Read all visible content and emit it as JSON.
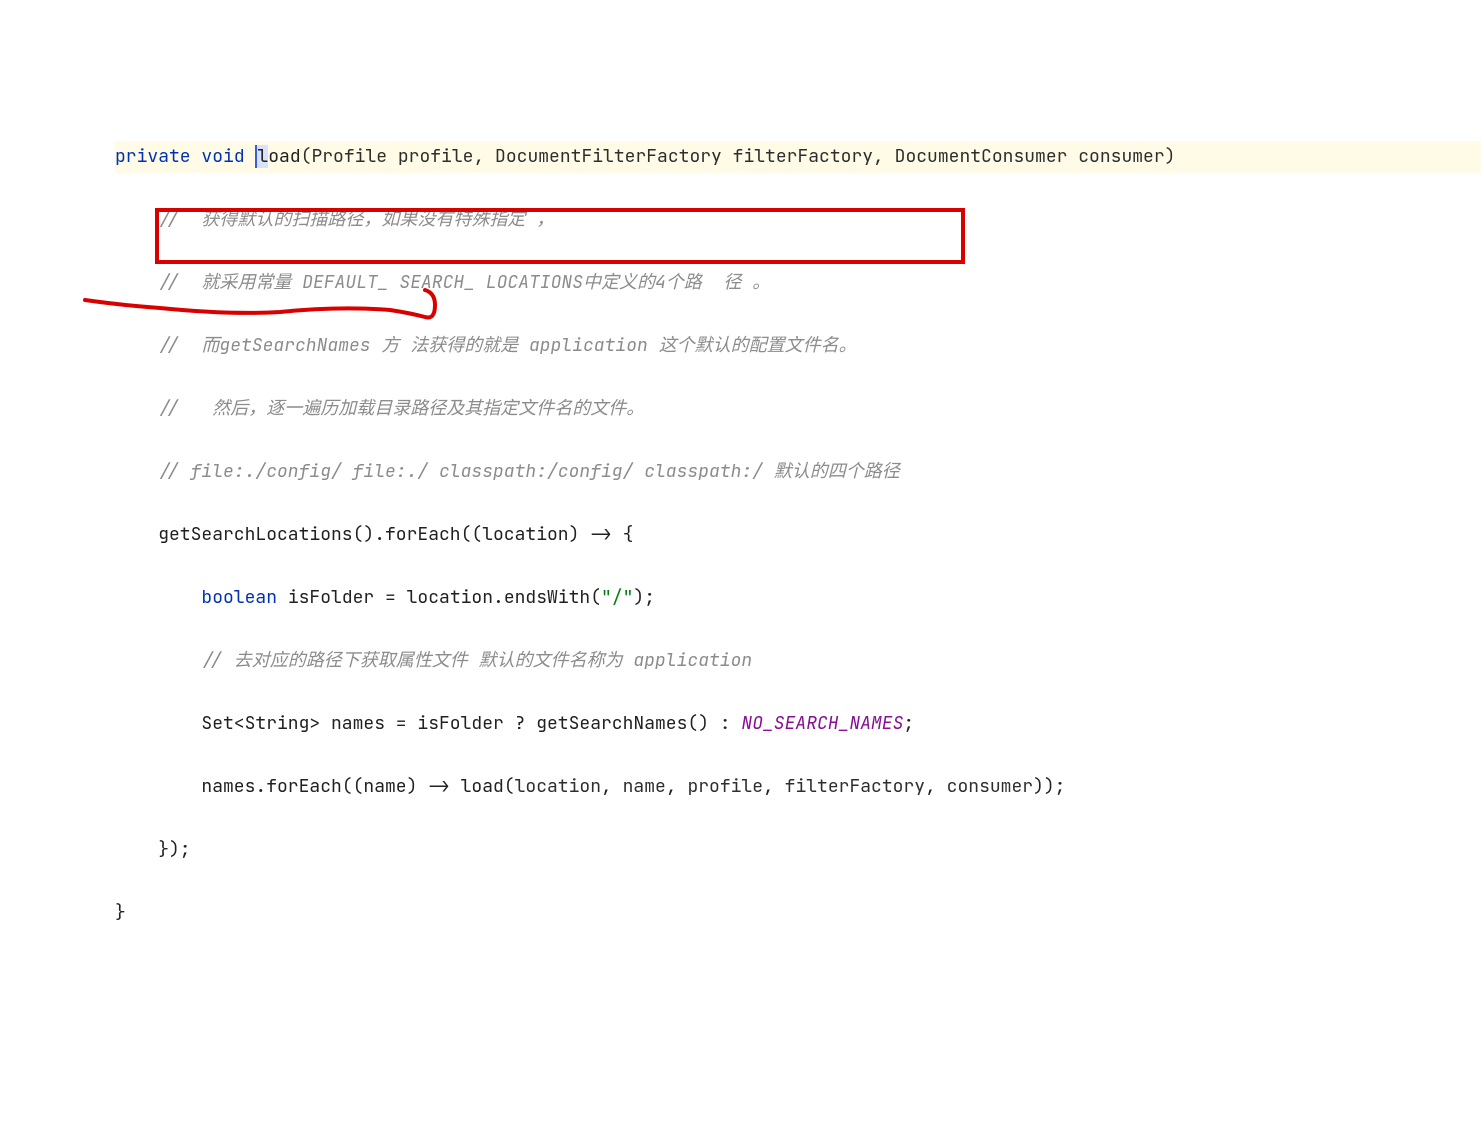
{
  "code": {
    "line1": {
      "kw_private": "private",
      "kw_void": "void",
      "cursor": "l",
      "method": "oad",
      "params": "(Profile profile, DocumentFilterFactory filterFactory, DocumentConsumer consumer)"
    },
    "c1": "//  获得默认的扫描路径，如果没有特殊指定 ，",
    "c2": "//  就采用常量 DEFAULT_ SEARCH_ LOCATIONS中定义的4个路  径 。",
    "c3": "//  而getSearchNames 方 法获得的就是 application 这个默认的配置文件名。",
    "c4": "//   然后，逐一遍历加载目录路径及其指定文件名的文件。",
    "c5": "// file:./config/ file:./ classpath:/config/ classpath:/ 默认的四个路径",
    "l6": "getSearchLocations().forEach((location) -> {",
    "l7": {
      "kw_bool": "boolean",
      "rest1": " isFolder = location.endsWith(",
      "str": "\"/\"",
      "rest2": ");"
    },
    "c8": "// 去对应的路径下获取属性文件 默认的文件名称为 application",
    "l9": {
      "pre": "Set<String> names = isFolder ? getSearchNames() : ",
      "const": "NO_SEARCH_NAMES",
      "post": ";"
    },
    "l10": {
      "pre": "names.forEach((name) -> load(",
      "a1": "location",
      "a2": "name",
      "a3": "profile",
      "a4": "filterFactory",
      "a5": "consumer",
      "post": "));"
    },
    "l11": "});",
    "l12": "}"
  }
}
